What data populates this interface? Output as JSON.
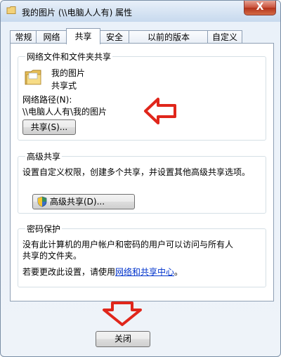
{
  "window": {
    "title": "我的图片 (\\\\电脑人人有) 属性",
    "close_glyph": "X",
    "accent_color": "#c8503a"
  },
  "tabs": [
    {
      "label": "常规"
    },
    {
      "label": "网络"
    },
    {
      "label": "共享"
    },
    {
      "label": "安全"
    },
    {
      "label": "以前的版本"
    },
    {
      "label": "自定义"
    }
  ],
  "active_tab": "共享",
  "network_share": {
    "group_title": "网络文件和文件夹共享",
    "folder_name": "我的图片",
    "folder_status": "共享式",
    "path_label": "网络路径(N):",
    "path_value": "\\\\电脑人人有\\我的图片",
    "share_button": "共享(S)..."
  },
  "advanced_share": {
    "group_title": "高级共享",
    "description": "设置自定义权限，创建多个共享，并设置其他高级共享选项。",
    "button_label": "高级共享(D)..."
  },
  "password": {
    "group_title": "密码保护",
    "line1": "没有此计算机的用户帐户和密码的用户可以访问与所有人",
    "line2": "共享的文件夹。",
    "change_prefix": "若要更改此设置，请使用",
    "link_text": "网络和共享中心",
    "change_suffix": "。"
  },
  "footer": {
    "close_button": "关闭"
  },
  "annotations": {
    "arrow_color": "#e0261b",
    "icons": [
      "folder-icon",
      "shield-icon",
      "close-icon",
      "left-arrow-icon",
      "down-arrow-icon"
    ]
  }
}
